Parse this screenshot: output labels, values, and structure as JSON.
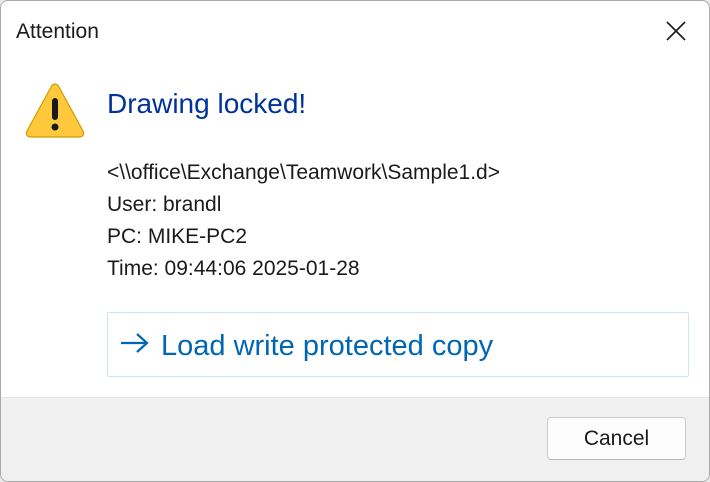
{
  "window": {
    "title": "Attention",
    "close_icon": "close-icon"
  },
  "message": {
    "icon": "warning-icon",
    "heading": "Drawing locked!",
    "path": "<\\\\office\\Exchange\\Teamwork\\Sample1.d>",
    "user": "User: brandl",
    "pc": "PC: MIKE-PC2",
    "time": "Time: 09:44:06 2025-01-28"
  },
  "command_link": {
    "icon": "arrow-right-icon",
    "label": "Load write protected copy"
  },
  "footer": {
    "cancel_label": "Cancel"
  },
  "colors": {
    "heading": "#003399",
    "link": "#0066b4",
    "warning_fill": "#ffc83d",
    "footer_bg": "#f0f0f0"
  }
}
